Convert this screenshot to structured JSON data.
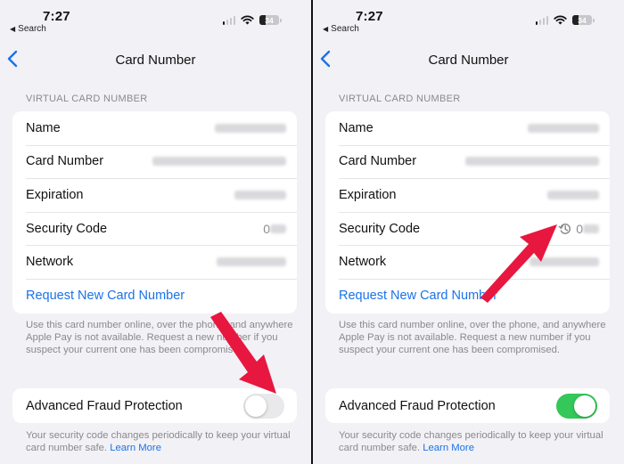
{
  "theme": {
    "accent": "#1a73e8",
    "toggle_on": "#34c759",
    "toggle_off": "#e9e9eb",
    "annotation_arrow": "#e8173f",
    "background": "#f2f1f6"
  },
  "panels": [
    {
      "status_bar": {
        "time": "7:27",
        "back_app": "Search",
        "battery_level": "34",
        "signal_bars_active": 1,
        "signal_bars_total": 4
      },
      "nav": {
        "back_icon": "chevron-left-icon",
        "title": "Card Number"
      },
      "section_header": "VIRTUAL CARD NUMBER",
      "rows": [
        {
          "label": "Name",
          "value": "[redacted]"
        },
        {
          "label": "Card Number",
          "value": "[redacted]"
        },
        {
          "label": "Expiration",
          "value": "[redacted]"
        },
        {
          "label": "Security Code",
          "value_prefix": "0",
          "value": "[redacted]",
          "rotation_icon": false
        },
        {
          "label": "Network",
          "value": "[redacted]"
        }
      ],
      "action_link": "Request New Card Number",
      "info_footer": "Use this card number online, over the phone, and anywhere Apple Pay is not available. Request a new number if you suspect your current one has been compromised.",
      "fraud_toggle": {
        "label": "Advanced Fraud Protection",
        "enabled": false
      },
      "fraud_footer": "Your security code changes periodically to keep your virtual card number safe.",
      "learn_more": "Learn More",
      "annotation": "arrow pointing to Advanced Fraud Protection toggle"
    },
    {
      "status_bar": {
        "time": "7:27",
        "back_app": "Search",
        "battery_level": "34",
        "signal_bars_active": 1,
        "signal_bars_total": 4
      },
      "nav": {
        "back_icon": "chevron-left-icon",
        "title": "Card Number"
      },
      "section_header": "VIRTUAL CARD NUMBER",
      "rows": [
        {
          "label": "Name",
          "value": "[redacted]"
        },
        {
          "label": "Card Number",
          "value": "[redacted]"
        },
        {
          "label": "Expiration",
          "value": "[redacted]"
        },
        {
          "label": "Security Code",
          "value_prefix": "0",
          "value": "[redacted]",
          "rotation_icon": true
        },
        {
          "label": "Network",
          "value": "[redacted]"
        }
      ],
      "action_link": "Request New Card Number",
      "info_footer": "Use this card number online, over the phone, and anywhere Apple Pay is not available. Request a new number if you suspect your current one has been compromised.",
      "fraud_toggle": {
        "label": "Advanced Fraud Protection",
        "enabled": true
      },
      "fraud_footer": "Your security code changes periodically to keep your virtual card number safe.",
      "learn_more": "Learn More",
      "annotation": "arrow pointing to security code rotation icon"
    }
  ]
}
